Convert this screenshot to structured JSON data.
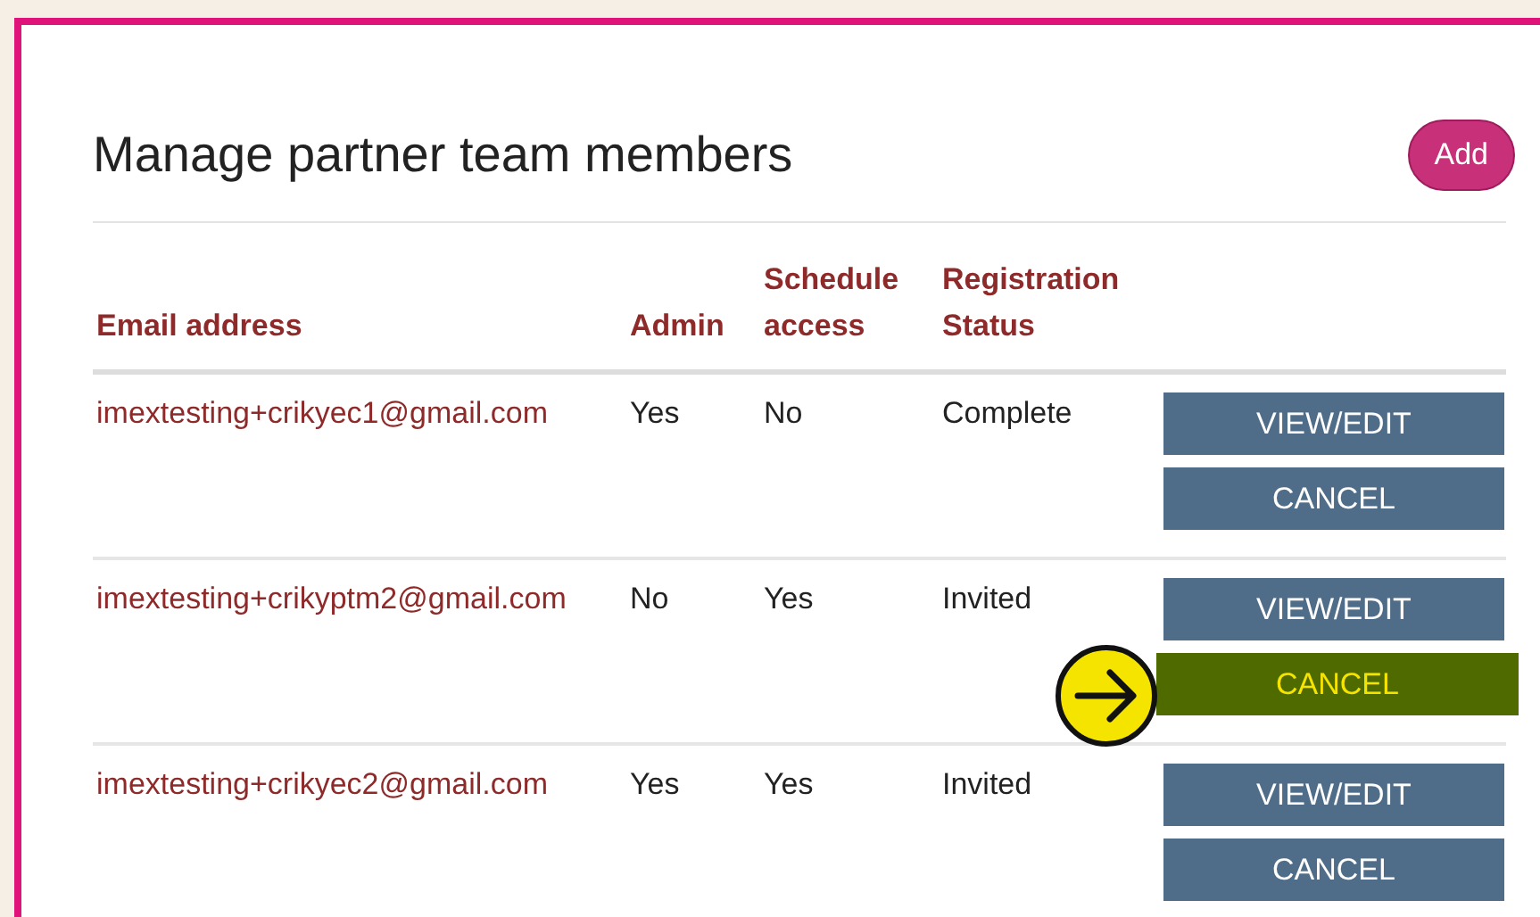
{
  "title": "Manage partner team members",
  "add_button": "Add",
  "table": {
    "columns": [
      "Email address",
      "Admin",
      "Schedule access",
      "Registration Status"
    ],
    "rows": [
      {
        "email": "imextesting+crikyec1@gmail.com",
        "admin": "Yes",
        "schedule": "No",
        "status": "Complete",
        "actions": [
          {
            "label": "VIEW/EDIT",
            "highlighted": false
          },
          {
            "label": "CANCEL",
            "highlighted": false
          }
        ]
      },
      {
        "email": "imextesting+crikyptm2@gmail.com",
        "admin": "No",
        "schedule": "Yes",
        "status": "Invited",
        "actions": [
          {
            "label": "VIEW/EDIT",
            "highlighted": false
          },
          {
            "label": "CANCEL",
            "highlighted": true
          }
        ]
      },
      {
        "email": "imextesting+crikyec2@gmail.com",
        "admin": "Yes",
        "schedule": "Yes",
        "status": "Invited",
        "actions": [
          {
            "label": "VIEW/EDIT",
            "highlighted": false
          },
          {
            "label": "CANCEL",
            "highlighted": false
          }
        ]
      }
    ]
  }
}
